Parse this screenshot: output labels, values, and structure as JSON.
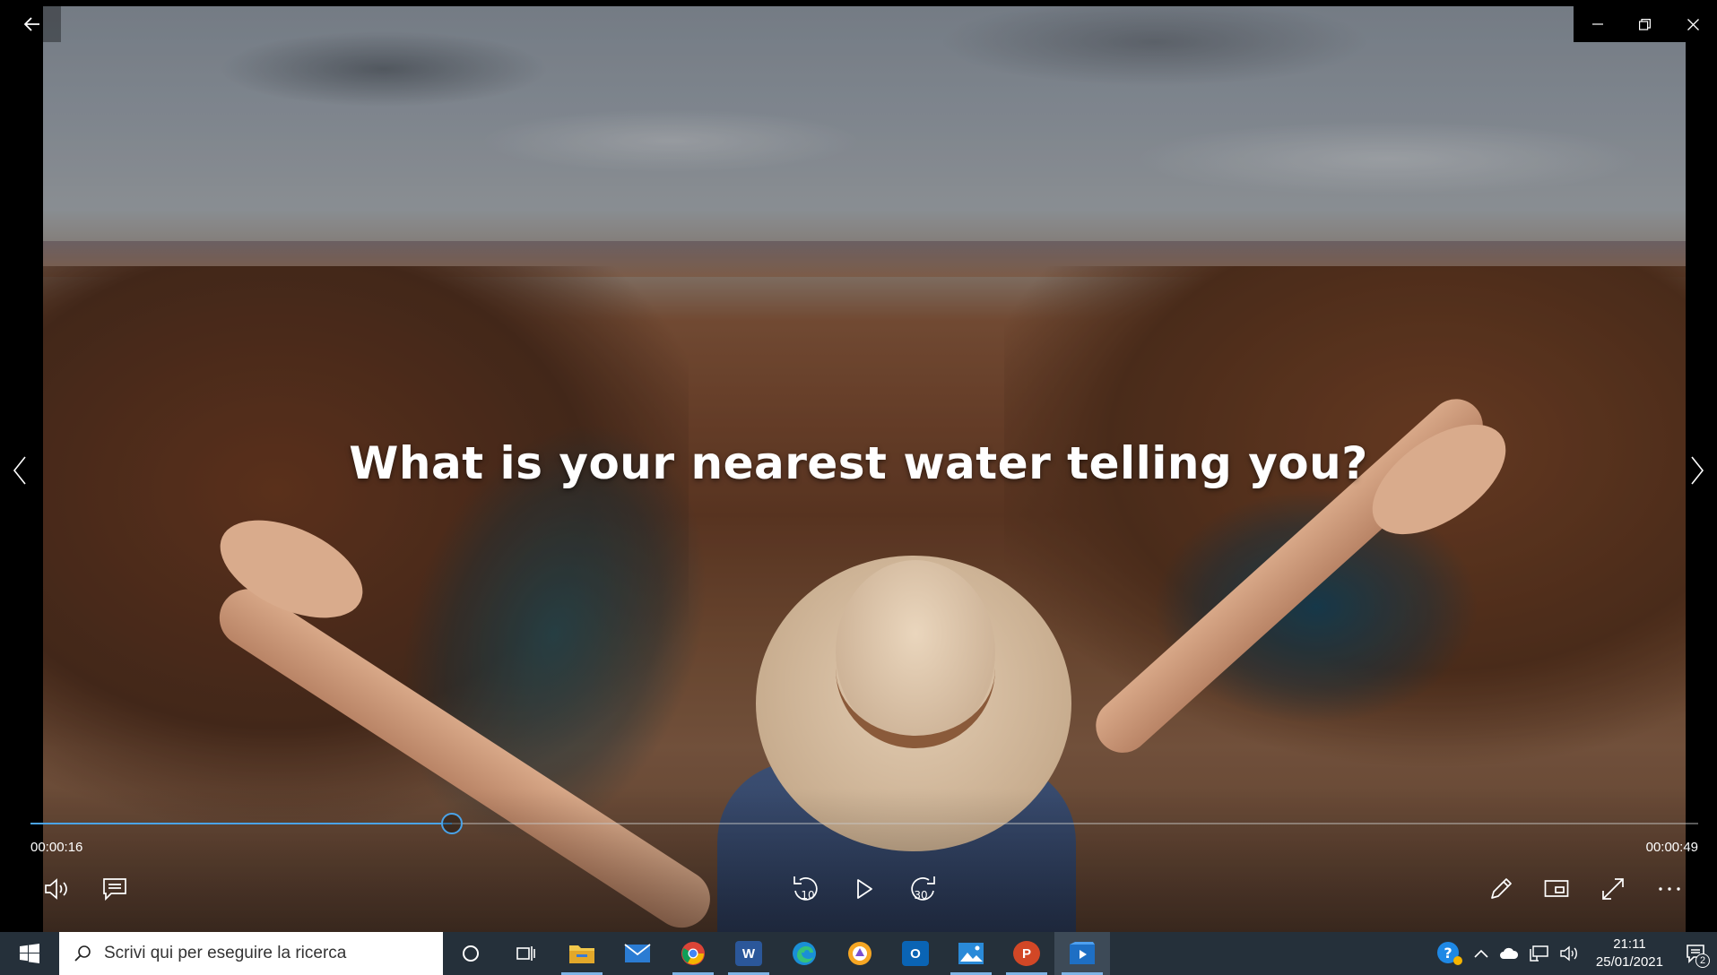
{
  "video": {
    "caption": "What is your nearest water telling you?"
  },
  "playback": {
    "current_time": "00:00:16",
    "total_time": "00:00:49",
    "progress_fraction": 0.2525,
    "skip_back_label": "10",
    "skip_forward_label": "30"
  },
  "colors": {
    "accent": "#4aa3e8",
    "taskbar": "#25303a"
  },
  "controls_left": [
    {
      "name": "volume-button",
      "icon": "speaker-icon"
    },
    {
      "name": "subtitles-button",
      "icon": "captions-icon"
    }
  ],
  "controls_center": [
    {
      "name": "skip-back-button",
      "icon": "rewind-10-icon"
    },
    {
      "name": "play-button",
      "icon": "play-icon"
    },
    {
      "name": "skip-forward-button",
      "icon": "forward-30-icon"
    }
  ],
  "controls_right": [
    {
      "name": "edit-button",
      "icon": "pencil-icon"
    },
    {
      "name": "mini-view-button",
      "icon": "mini-view-icon"
    },
    {
      "name": "fullscreen-button",
      "icon": "expand-icon"
    },
    {
      "name": "more-button",
      "icon": "more-icon"
    }
  ],
  "taskbar": {
    "search_placeholder": "Scrivi qui per eseguire la ricerca",
    "apps": [
      {
        "name": "cortana",
        "icon": "cortana-circle-icon"
      },
      {
        "name": "task-view",
        "icon": "task-view-icon"
      },
      {
        "name": "file-explorer",
        "icon": "folder-icon",
        "active": true
      },
      {
        "name": "mail",
        "icon": "mail-icon"
      },
      {
        "name": "chrome",
        "icon": "chrome-icon",
        "active": true
      },
      {
        "name": "word",
        "icon": "word-icon",
        "active": true,
        "letter": "W"
      },
      {
        "name": "edge",
        "icon": "edge-icon"
      },
      {
        "name": "browser",
        "icon": "browser-icon"
      },
      {
        "name": "outlook",
        "icon": "outlook-icon",
        "letter": "O"
      },
      {
        "name": "photos",
        "icon": "photos-icon",
        "active": true
      },
      {
        "name": "powerpoint",
        "icon": "powerpoint-icon",
        "active": true,
        "letter": "P"
      },
      {
        "name": "movies-tv",
        "icon": "video-player-icon",
        "active": true,
        "current": true
      }
    ],
    "clock_time": "21:11",
    "clock_date": "25/01/2021",
    "notification_count": "2"
  }
}
